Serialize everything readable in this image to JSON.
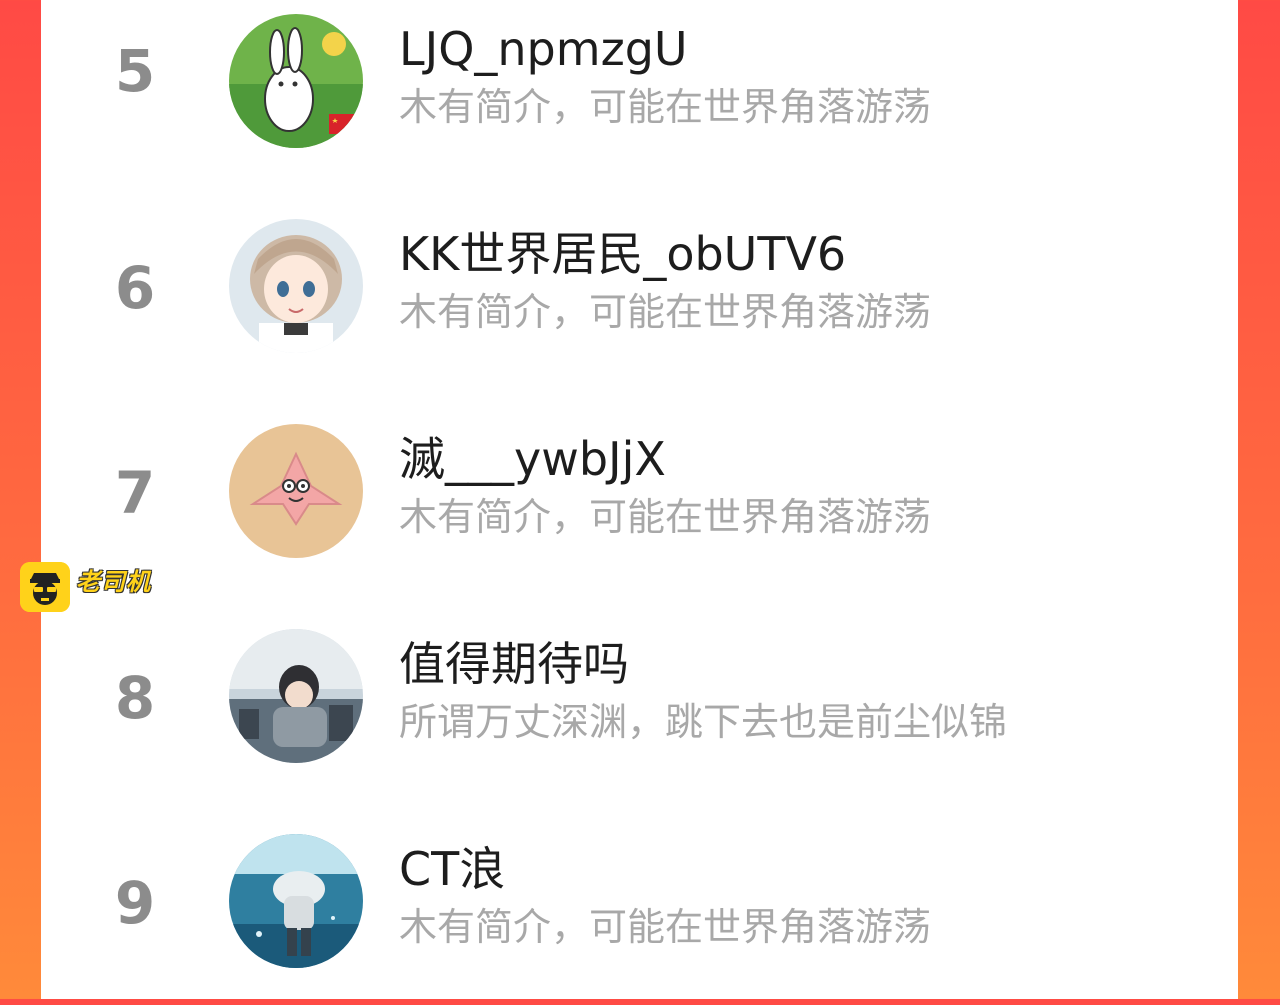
{
  "ranking": [
    {
      "rank": "5",
      "name": "LJQ_npmzgU",
      "intro": "木有简介，可能在世界角落游荡",
      "avatar": "cartoon-rabbit-avatar"
    },
    {
      "rank": "6",
      "name": "KK世界居民_obUTV6",
      "intro": "木有简介，可能在世界角落游荡",
      "avatar": "anime-girl-avatar"
    },
    {
      "rank": "7",
      "name": "滅___ywbJjX",
      "intro": "木有简介，可能在世界角落游荡",
      "avatar": "pink-starfish-avatar"
    },
    {
      "rank": "8",
      "name": "值得期待吗",
      "intro": "所谓万丈深渊，跳下去也是前尘似锦",
      "avatar": "anime-boy-avatar"
    },
    {
      "rank": "9",
      "name": "CT浪",
      "intro": "木有简介，可能在世界角落游荡",
      "avatar": "underwater-figure-avatar"
    }
  ],
  "watermark": {
    "title": "老司机",
    "url": "- lsjmh.xyz -",
    "icon": "driver-face-icon"
  },
  "colors": {
    "background_left": "#ff4a45",
    "background_right": "#ff8a3a",
    "rank_text": "#8c8c8c",
    "name_text": "#1d1d1d",
    "intro_text": "#a8a8a8",
    "watermark_yellow": "#ffd21a"
  }
}
